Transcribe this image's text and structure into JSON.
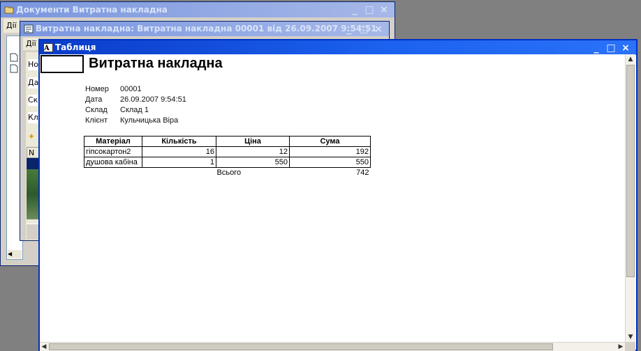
{
  "window1": {
    "title": "Документи Витратна накладна",
    "menu_label": "Дії",
    "buttons": [
      "_",
      "□",
      "×"
    ]
  },
  "window2": {
    "title": "Витратна накладна: Витратна накладна 00001 від 26.09.2007 9:54:51",
    "menu_label": "Дії",
    "partial_labels": [
      "Но",
      "Да",
      "Ск",
      "Клі",
      "N"
    ]
  },
  "window3": {
    "title": "Таблиця",
    "buttons": [
      "_",
      "□",
      "×"
    ]
  },
  "document": {
    "heading": "Витратна накладна",
    "fields": [
      {
        "label": "Номер",
        "value": "00001"
      },
      {
        "label": "Дата",
        "value": "26.09.2007 9:54:51"
      },
      {
        "label": "Склад",
        "value": "Склад 1"
      },
      {
        "label": "Клієнт",
        "value": "Кульчицька Віра"
      }
    ],
    "table": {
      "headers": [
        "Матеріал",
        "Кількість",
        "Ціна",
        "Сума"
      ],
      "rows": [
        [
          "гіпсокартон2",
          "16",
          "12",
          "192"
        ],
        [
          "душова кабіна",
          "1",
          "550",
          "550"
        ]
      ],
      "total_label": "Всього",
      "total_value": "742"
    }
  },
  "colors": {
    "active_title": "#0a3cc8",
    "inactive_title": "#7a96df",
    "desktop": "#808080"
  }
}
